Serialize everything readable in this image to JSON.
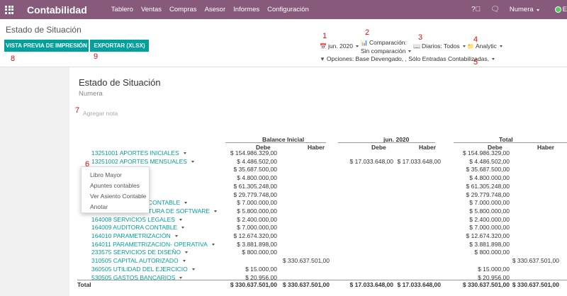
{
  "nav": {
    "brand": "Contabilidad",
    "menu": [
      "Tablero",
      "Ventas",
      "Compras",
      "Asesor",
      "Informes",
      "Configuración"
    ],
    "company": "Numera",
    "user_initial": "E"
  },
  "breadcrumb": "Estado de Situación",
  "buttons": {
    "preview": "VISTA PREVIA DE IMPRESIÓN",
    "export": "EXPORTAR (XLSX)"
  },
  "filters": {
    "date": "jun. 2020",
    "comparison_title": "Comparación:",
    "comparison_value": "Sin comparación",
    "journals": "Diarios: Todos",
    "analytic": "Analytic",
    "options": "Opciones: Base Devengado, , Sólo Entradas Contabilizadas,"
  },
  "annotations": [
    "1",
    "2",
    "3",
    "4",
    "5",
    "6",
    "7",
    "8",
    "9"
  ],
  "report": {
    "title": "Estado de Situación",
    "company": "Numera",
    "add_note": "Agregar nota",
    "groups": [
      "Balance Inicial",
      "jun. 2020",
      "Total"
    ],
    "columns": [
      "Debe",
      "Haber",
      "Debe",
      "Haber",
      "Debe",
      "Haber"
    ],
    "rows": [
      {
        "account": "13251001 APORTES INICIALES",
        "values": [
          "$ 154.986.329,00",
          "",
          "",
          "",
          "$ 154.986.329,00",
          ""
        ]
      },
      {
        "account": "13251002 APORTES MENSUALES",
        "values": [
          "$ 4.486.502,00",
          "",
          "$ 17.033.648,00",
          "$ 17.033.648,00",
          "$ 4.486.502,00",
          ""
        ]
      },
      {
        "account": "",
        "values": [
          "$ 35.687.500,00",
          "",
          "",
          "",
          "$ 35.687.500,00",
          ""
        ]
      },
      {
        "account": "",
        "values": [
          "$ 4.800.000,00",
          "",
          "",
          "",
          "$ 4.800.000,00",
          ""
        ]
      },
      {
        "account": "",
        "values": [
          "$ 61.305.248,00",
          "",
          "",
          "",
          "$ 61.305.248,00",
          ""
        ]
      },
      {
        "account": "",
        "values": [
          "$ 29.779.748,00",
          "",
          "",
          "",
          "$ 29.779.748,00",
          ""
        ]
      },
      {
        "account": "CONTABLE",
        "values": [
          "$ 7.000.000,00",
          "",
          "",
          "",
          "$ 7.000.000,00",
          ""
        ]
      },
      {
        "account": "TURA DE SOFTWARE",
        "values": [
          "$ 5.800.000,00",
          "",
          "",
          "",
          "$ 5.800.000,00",
          ""
        ]
      },
      {
        "account": "164008 SERVICIOS LEGALES",
        "values": [
          "$ 2.400.000,00",
          "",
          "",
          "",
          "$ 2.400.000,00",
          ""
        ]
      },
      {
        "account": "164009 AUDITORA CONTABLE",
        "values": [
          "$ 7.000.000,00",
          "",
          "",
          "",
          "$ 7.000.000,00",
          ""
        ]
      },
      {
        "account": "164010 PARAMETRIZACIÓN",
        "values": [
          "$ 12.674.320,00",
          "",
          "",
          "",
          "$ 12.674.320,00",
          ""
        ]
      },
      {
        "account": "164011 PARAMETRIZACION- OPERATIVA",
        "values": [
          "$ 3.881.898,00",
          "",
          "",
          "",
          "$ 3.881.898,00",
          ""
        ]
      },
      {
        "account": "233575 SERVICIOS DE DISEÑO",
        "values": [
          "$ 800.000,00",
          "",
          "",
          "",
          "$ 800.000,00",
          ""
        ]
      },
      {
        "account": "310505 CAPITAL AUTORIZADO",
        "values": [
          "",
          "$ 330.637.501,00",
          "",
          "",
          "",
          "$ 330.637.501,00"
        ]
      },
      {
        "account": "360505 UTILIDAD DEL EJERCICIO",
        "values": [
          "$ 15.000,00",
          "",
          "",
          "",
          "$ 15.000,00",
          ""
        ]
      },
      {
        "account": "530505 GASTOS BANCARIOS",
        "values": [
          "$ 20.956,00",
          "",
          "",
          "",
          "$ 20.956,00",
          ""
        ]
      }
    ],
    "total": {
      "label": "Total",
      "values": [
        "$ 330.637.501,00",
        "$ 330.637.501,00",
        "$ 17.033.648,00",
        "$ 17.033.648,00",
        "$ 330.637.501,00",
        "$ 330.637.501,00"
      ]
    }
  },
  "dropdown": [
    "Libro Mayor",
    "Apuntes contables",
    "Ver Asiento Contable",
    "Anotar"
  ],
  "colors": {
    "nav": "#875A7B",
    "accent": "#00A09D",
    "annotation": "#d01010"
  }
}
